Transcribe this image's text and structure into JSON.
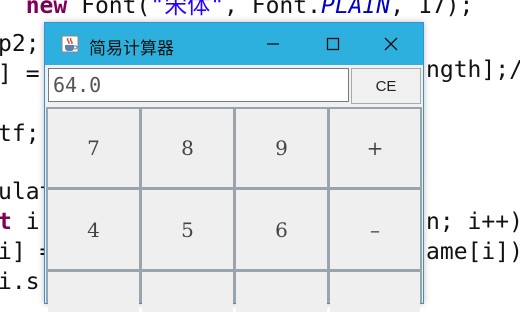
{
  "editor": {
    "lines": [
      [
        {
          "t": "  "
        },
        {
          "t": "new",
          "c": "kw"
        },
        {
          "t": " Font("
        },
        {
          "t": "\"宋体\"",
          "c": "str"
        },
        {
          "t": ", Font."
        },
        {
          "t": "PLAIN",
          "c": "ital"
        },
        {
          "t": ", 17);"
        }
      ],
      [
        {
          "t": "p2;"
        }
      ],
      [
        {
          "t": "] ="
        }
      ],
      [
        {
          "t": "tf;"
        }
      ],
      [
        {
          "t": "ulat"
        }
      ],
      [
        {
          "t": "t",
          "c": "kw"
        },
        {
          "t": " i"
        }
      ],
      [
        {
          "t": "i] ="
        }
      ],
      [
        {
          "t": "i.s"
        }
      ]
    ],
    "right_fragments": [
      "ngth];/",
      "n; i++)",
      "ame[i])"
    ]
  },
  "window": {
    "title": "简易计算器",
    "minimize_glyph": "–",
    "maximize_glyph": "□",
    "close_glyph": "×",
    "accent_color": "#2db0dd"
  },
  "display": {
    "value": "64.0"
  },
  "ce_label": "CE",
  "keys": [
    {
      "label": "7"
    },
    {
      "label": "8"
    },
    {
      "label": "9"
    },
    {
      "label": "+"
    },
    {
      "label": "4"
    },
    {
      "label": "5"
    },
    {
      "label": "6"
    },
    {
      "label": "–"
    },
    {
      "label": ""
    },
    {
      "label": ""
    },
    {
      "label": ""
    },
    {
      "label": ""
    }
  ]
}
